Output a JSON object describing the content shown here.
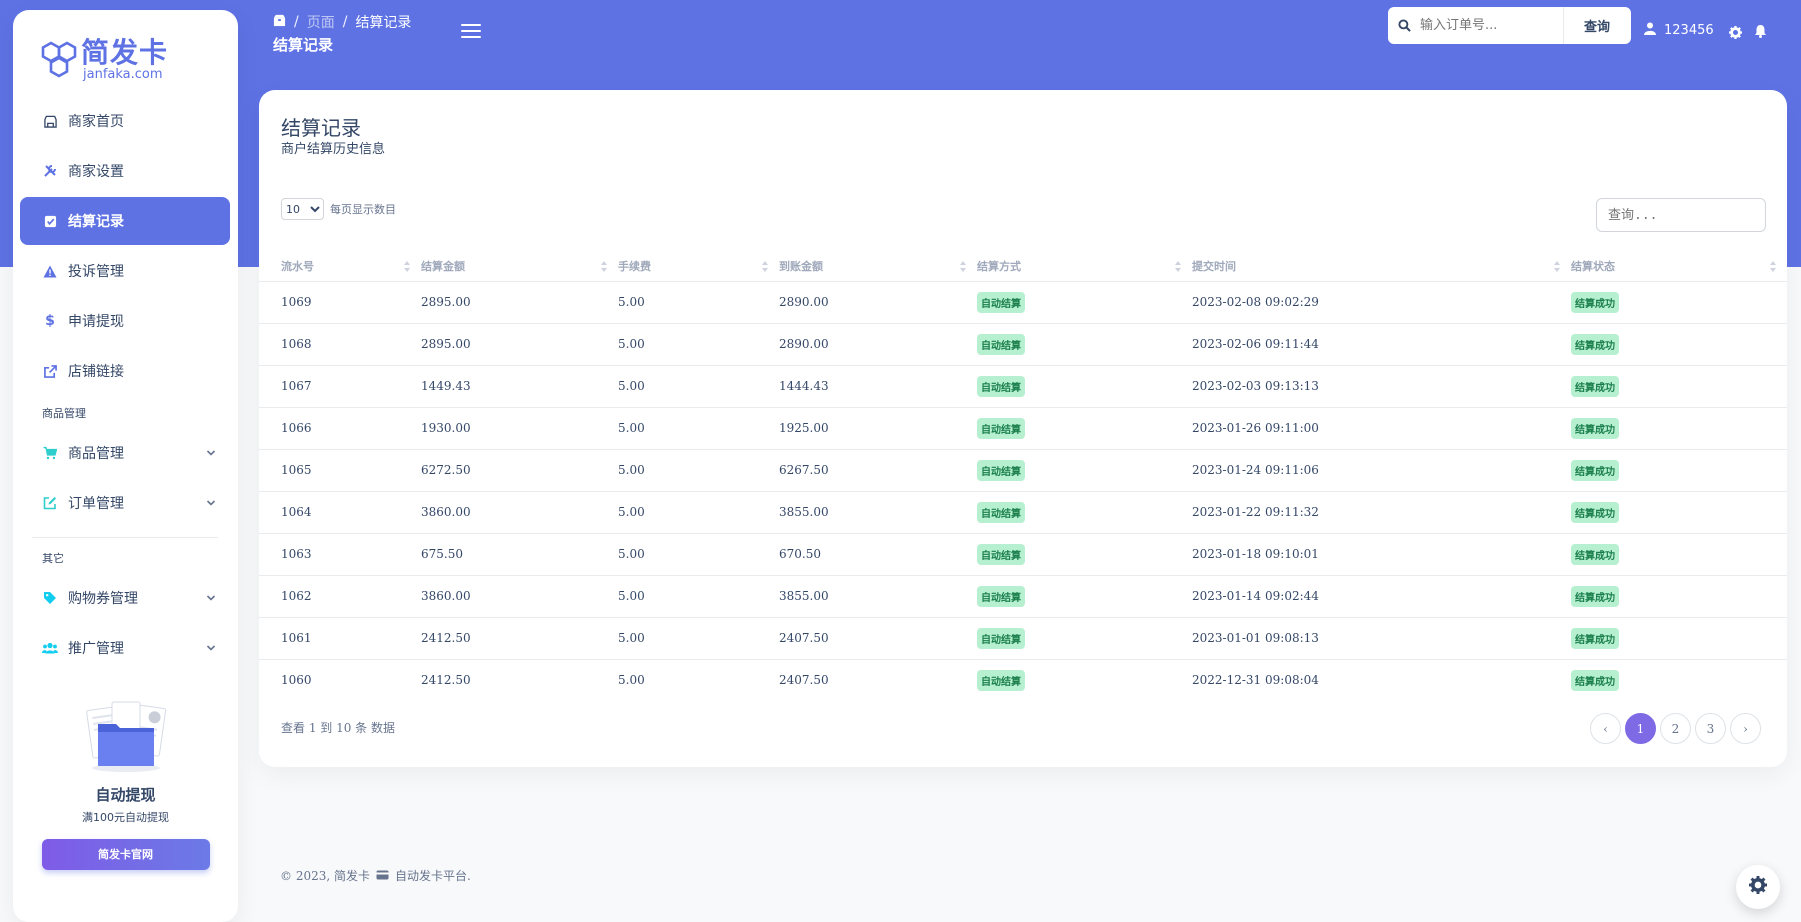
{
  "brand": {
    "title": "简发卡",
    "subtitle": "janfaka.com"
  },
  "colors": {
    "primary": "#5e72e4",
    "success_bg": "#b7f0d0",
    "success_text": "#1a7f4b"
  },
  "sidebar": {
    "items": [
      {
        "label": "商家首页",
        "icon": "store-icon"
      },
      {
        "label": "商家设置",
        "icon": "tools-icon"
      },
      {
        "label": "结算记录",
        "icon": "check-square-icon",
        "active": true
      },
      {
        "label": "投诉管理",
        "icon": "warning-icon"
      },
      {
        "label": "申请提现",
        "icon": "dollar-icon"
      },
      {
        "label": "店铺链接",
        "icon": "external-link-icon"
      }
    ],
    "section_goods": "商品管理",
    "goods_items": [
      {
        "label": "商品管理",
        "icon": "cart-icon"
      },
      {
        "label": "订单管理",
        "icon": "edit-icon"
      }
    ],
    "section_other": "其它",
    "other_items": [
      {
        "label": "购物券管理",
        "icon": "tag-icon"
      },
      {
        "label": "推广管理",
        "icon": "users-icon"
      }
    ],
    "promo": {
      "title": "自动提现",
      "subtitle": "满100元自动提现",
      "button": "简发卡官网"
    }
  },
  "header": {
    "breadcrumb": [
      "页面",
      "结算记录"
    ],
    "title": "结算记录",
    "search_placeholder": "输入订单号...",
    "search_button": "查询",
    "username": "123456"
  },
  "card": {
    "title": "结算记录",
    "subtitle": "商户结算历史信息",
    "page_length": "10",
    "page_length_label": "每页显示数目",
    "search_placeholder": "查询..."
  },
  "table": {
    "columns": [
      "流水号",
      "结算金额",
      "手续费",
      "到账金额",
      "结算方式",
      "提交时间",
      "结算状态"
    ],
    "rows": [
      [
        "1069",
        "2895.00",
        "5.00",
        "2890.00",
        "自动结算",
        "2023-02-08 09:02:29",
        "结算成功"
      ],
      [
        "1068",
        "2895.00",
        "5.00",
        "2890.00",
        "自动结算",
        "2023-02-06 09:11:44",
        "结算成功"
      ],
      [
        "1067",
        "1449.43",
        "5.00",
        "1444.43",
        "自动结算",
        "2023-02-03 09:13:13",
        "结算成功"
      ],
      [
        "1066",
        "1930.00",
        "5.00",
        "1925.00",
        "自动结算",
        "2023-01-26 09:11:00",
        "结算成功"
      ],
      [
        "1065",
        "6272.50",
        "5.00",
        "6267.50",
        "自动结算",
        "2023-01-24 09:11:06",
        "结算成功"
      ],
      [
        "1064",
        "3860.00",
        "5.00",
        "3855.00",
        "自动结算",
        "2023-01-22 09:11:32",
        "结算成功"
      ],
      [
        "1063",
        "675.50",
        "5.00",
        "670.50",
        "自动结算",
        "2023-01-18 09:10:01",
        "结算成功"
      ],
      [
        "1062",
        "3860.00",
        "5.00",
        "3855.00",
        "自动结算",
        "2023-01-14 09:02:44",
        "结算成功"
      ],
      [
        "1061",
        "2412.50",
        "5.00",
        "2407.50",
        "自动结算",
        "2023-01-01 09:08:13",
        "结算成功"
      ],
      [
        "1060",
        "2412.50",
        "5.00",
        "2407.50",
        "自动结算",
        "2022-12-31 09:08:04",
        "结算成功"
      ]
    ]
  },
  "pagination": {
    "info": "查看 1 到 10 条 数据",
    "prev": "‹",
    "pages": [
      "1",
      "2",
      "3"
    ],
    "current": "1",
    "next": "›"
  },
  "footer": {
    "copyright": "© 2023, 简发卡",
    "platform": "自动发卡平台."
  }
}
